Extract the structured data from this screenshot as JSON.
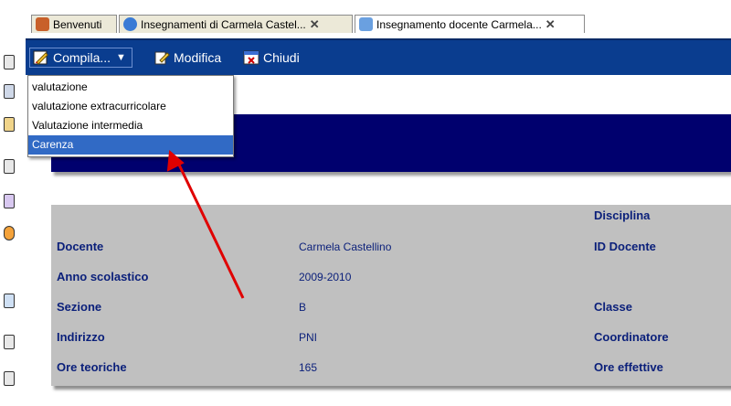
{
  "tabs": [
    {
      "label": "Benvenuti",
      "closable": false,
      "active": false,
      "icon": "home-icon"
    },
    {
      "label": "Insegnamenti di Carmela Castel...",
      "closable": true,
      "active": false,
      "icon": "globe-icon"
    },
    {
      "label": "Insegnamento docente Carmela...",
      "closable": true,
      "active": true,
      "icon": "document-icon"
    }
  ],
  "toolbar": {
    "compila_label": "Compila...",
    "modifica_label": "Modifica",
    "chiudi_label": "Chiudi"
  },
  "dropdown": {
    "items": [
      "valutazione",
      "valutazione extracurricolare",
      "Valutazione intermedia",
      "Carenza"
    ],
    "selected_index": 3
  },
  "info": {
    "disciplina_label": "Disciplina",
    "docente_label": "Docente",
    "docente_value": "Carmela Castellino",
    "id_docente_label": "ID Docente",
    "anno_label": "Anno scolastico",
    "anno_value": "2009-2010",
    "sezione_label": "Sezione",
    "sezione_value": "B",
    "classe_label": "Classe",
    "indirizzo_label": "Indirizzo",
    "indirizzo_value": "PNI",
    "coordinatore_label": "Coordinatore",
    "ore_teoriche_label": "Ore teoriche",
    "ore_teoriche_value": "165",
    "ore_effettive_label": "Ore effettive"
  },
  "colors": {
    "toolbar": "#0a3d8f",
    "band": "#00006e",
    "panel": "#c0c0c0",
    "label_text": "#0a1f7a",
    "selection": "#316ac5",
    "annotation_arrow": "#e00000"
  }
}
